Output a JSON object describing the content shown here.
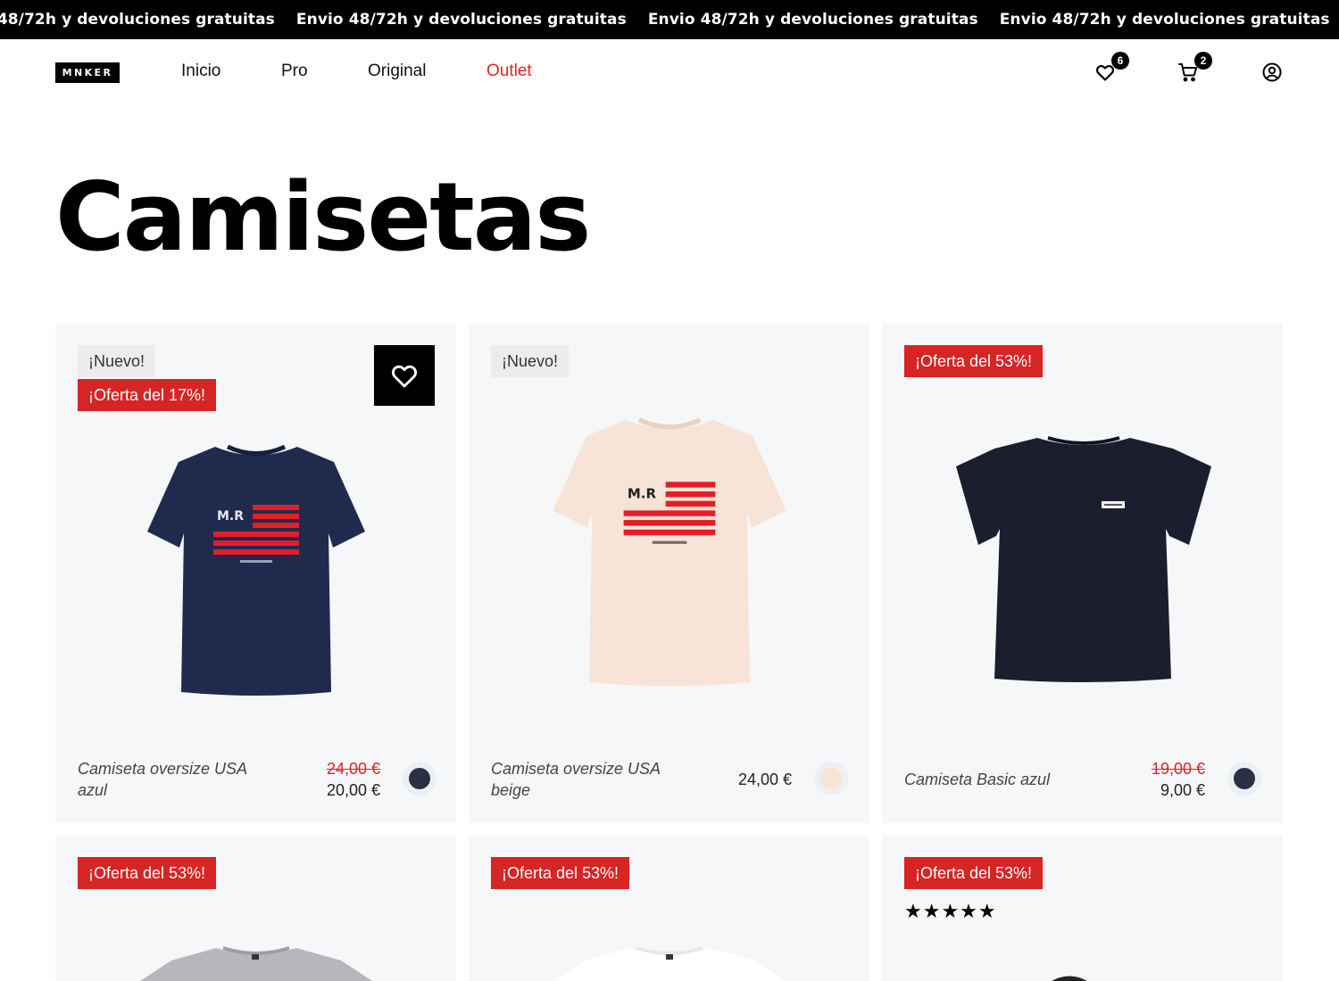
{
  "announcement": {
    "text": "Envio 48/72h y devoluciones gratuitas"
  },
  "header": {
    "logo": "MNKER",
    "nav": [
      {
        "label": "Inicio"
      },
      {
        "label": "Pro"
      },
      {
        "label": "Original"
      },
      {
        "label": "Outlet"
      }
    ],
    "wishlist_count": "6",
    "cart_count": "2"
  },
  "page": {
    "title": "Camisetas"
  },
  "colors": {
    "accent": "#d62525",
    "navy": "#1f2a4d",
    "beige": "#f5e3d3",
    "black_shirt": "#1c1d2e"
  },
  "products": [
    {
      "badge_new": "¡Nuevo!",
      "badge_sale": "¡Oferta del 17%!",
      "name": "Camiseta oversize USA azul",
      "old_price": "24,00 €",
      "price": "20,00 €",
      "swatch_color": "#2a3048"
    },
    {
      "badge_new": "¡Nuevo!",
      "name": "Camiseta oversize USA beige",
      "price": "24,00 €",
      "swatch_color": "#f7e4d6"
    },
    {
      "badge_sale": "¡Oferta del 53%!",
      "name": "Camiseta Basic azul",
      "old_price": "19,00 €",
      "price": "9,00 €",
      "swatch_color": "#2a3048"
    },
    {
      "badge_sale": "¡Oferta del 53%!"
    },
    {
      "badge_sale": "¡Oferta del 53%!"
    },
    {
      "badge_sale": "¡Oferta del 53%!",
      "rating_stars": "★★★★★",
      "rating": 5
    }
  ]
}
